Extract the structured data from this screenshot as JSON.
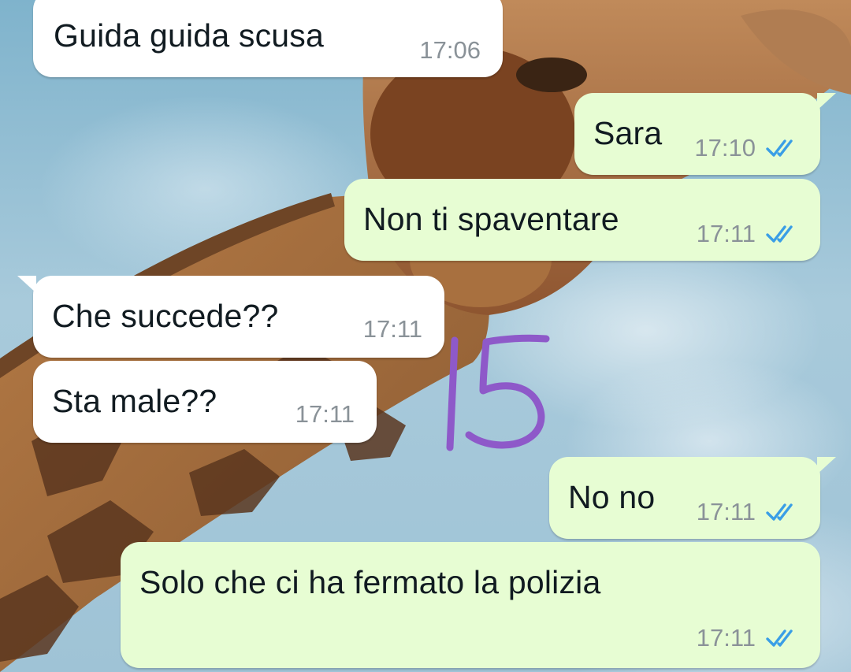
{
  "messages": [
    {
      "id": "m1",
      "direction": "incoming",
      "text": "Guida guida scusa",
      "time": "17:06",
      "read": false
    },
    {
      "id": "m2",
      "direction": "outgoing",
      "text": "Sara",
      "time": "17:10",
      "read": true
    },
    {
      "id": "m3",
      "direction": "outgoing",
      "text": "Non ti spaventare",
      "time": "17:11",
      "read": true
    },
    {
      "id": "m4",
      "direction": "incoming",
      "text": "Che succede??",
      "time": "17:11",
      "read": false
    },
    {
      "id": "m5",
      "direction": "incoming",
      "text": "Sta male??",
      "time": "17:11",
      "read": false
    },
    {
      "id": "m6",
      "direction": "outgoing",
      "text": "No no",
      "time": "17:11",
      "read": true
    },
    {
      "id": "m7",
      "direction": "outgoing",
      "text": "Solo che ci ha fermato la polizia",
      "time": "17:11",
      "read": true
    }
  ],
  "annotation": {
    "text": "15",
    "color": "#8e59c9"
  },
  "colors": {
    "incoming_bubble": "#ffffff",
    "outgoing_bubble": "#e7fdd3",
    "read_ticks": "#3a9ee6",
    "timestamp": "#8a9298"
  },
  "wallpaper": "giraffe-sky-photo"
}
